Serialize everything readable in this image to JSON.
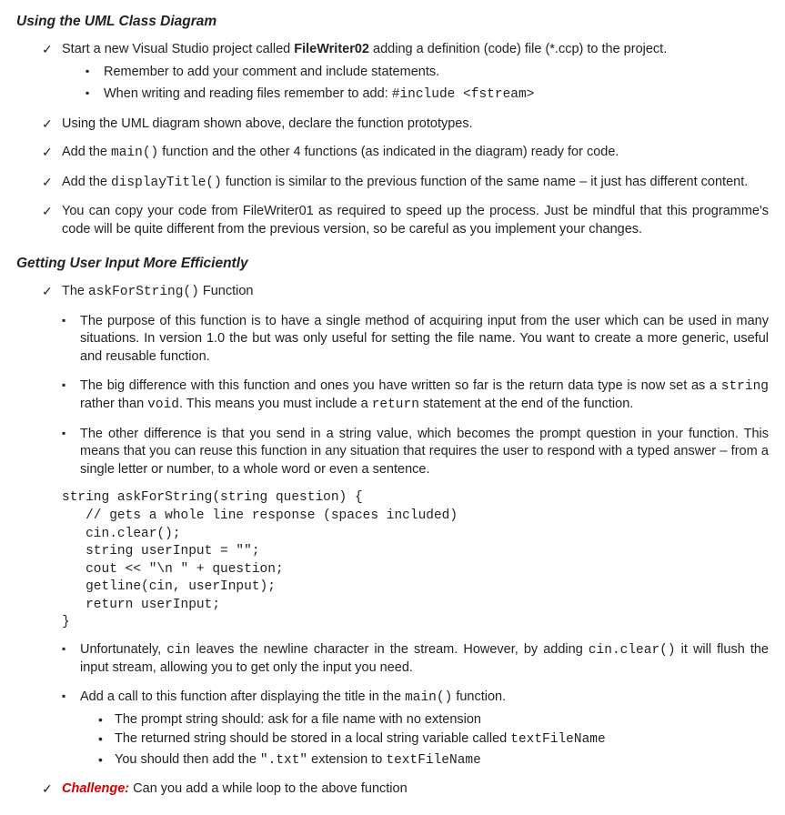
{
  "section1": {
    "heading": "Using the UML Class Diagram",
    "items": [
      {
        "pre": "Start a new Visual Studio project called ",
        "bold": "FileWriter02",
        "post": " adding a definition (code) file (*.ccp) to the project.",
        "subs": [
          {
            "text": "Remember to add your comment and include statements."
          },
          {
            "pre": "When writing and reading files remember to add: ",
            "code": "#include <fstream>"
          }
        ]
      },
      {
        "text": "Using the UML diagram shown above, declare the function prototypes."
      },
      {
        "pre": "Add the ",
        "code": "main()",
        "post": " function and the other 4 functions (as indicated in the diagram) ready for code."
      },
      {
        "pre": "Add the ",
        "code": "displayTitle()",
        "post": " function is similar to the previous function of the same name – it just has different content."
      },
      {
        "text": "You can copy your code from FileWriter01 as required to speed up the process. Just be mindful that this programme's code will be quite different from the previous version, so be careful as you implement your changes."
      }
    ]
  },
  "section2": {
    "heading": "Getting User Input More Efficiently",
    "intro_pre": "The ",
    "intro_code": "askForString()",
    "intro_post": " Function",
    "bullets": [
      {
        "text": "The purpose of this function is to have a single method of acquiring input from the user which can be used in many situations. In version 1.0 the but was only useful for setting the file name. You want to create a more generic, useful and reusable function."
      },
      {
        "t1": "The big difference with this function and ones you have written so far is the return data type is now set as a ",
        "c1": "string",
        "t2": " rather than ",
        "c2": "void",
        "t3": ". This means you must include a ",
        "c3": "return",
        "t4": " statement at the end of the function."
      },
      {
        "text": "The other difference is that you send in a string value, which becomes the prompt question in your function. This means that you can reuse this function in any situation that requires the user to respond with a typed answer – from a single letter or number, to a whole word or even a sentence."
      }
    ],
    "code": "string askForString(string question) {\n   // gets a whole line response (spaces included)\n   cin.clear();\n   string userInput = \"\";\n   cout << \"\\n \" + question;\n   getline(cin, userInput);\n   return userInput;\n}",
    "bullets2": [
      {
        "t1": "Unfortunately, ",
        "c1": "cin",
        "t2": " leaves the newline character in the stream. However, by adding ",
        "c2": "cin.clear()",
        "t3": " it will flush the input stream, allowing you to get only the input you need."
      },
      {
        "t1": "Add a call to this function after displaying the title in the ",
        "c1": "main()",
        "t2": " function.",
        "dots": [
          {
            "text": "The prompt string should: ask for a file name with no extension"
          },
          {
            "t1": "The returned string should be stored in a local string variable called ",
            "c1": "textFileName"
          },
          {
            "t1": "You should then add the ",
            "c1": "\".txt\"",
            "t2": " extension to ",
            "c2": "textFileName"
          }
        ]
      }
    ],
    "challenge_label": "Challenge:",
    "challenge_text": " Can you add a while loop to the above function"
  }
}
